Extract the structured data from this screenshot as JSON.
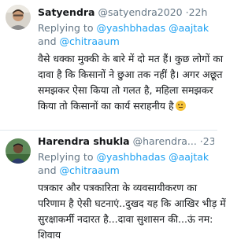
{
  "tweets": [
    {
      "name": "Satyendra",
      "handle": "@satyendra2020",
      "separator": "·",
      "time": "22h",
      "reply_prefix": "Replying to",
      "mention1": "@yashbhadas",
      "mention2": "@aajtak",
      "and_word": "and",
      "mention3": "@chitraaum",
      "lines": [
        "वैसे धक्का मुक्की के बारे में दो मत हैं। कुछ लोगों का",
        "दावा है कि किसानों ने छुआ तक नहीं है।  अगर अछूत",
        "समझकर ऐसा किया तो गलत है, महिला समझकर",
        "किया तो किसानों का कार्य सराहनीय है"
      ],
      "emoji": "thinking-face-emoji"
    },
    {
      "name": "Harendra shukla",
      "handle": "@harendra...",
      "separator": "·",
      "time": "23h",
      "reply_prefix": "Replying to",
      "mention1": "@yashbhadas",
      "mention2": "@aajtak",
      "and_word": "and",
      "mention3": "@chitraaum",
      "lines": [
        "पत्रकार और पत्रकारिता के व्यवसायीकरण का",
        "परिणाम है ऐसी घटनाएं..दुखद यह कि आखिर भीड़ में",
        "सुरक्षाकर्मी नदारत है...दावा सुशासन की...ऊं नम:",
        "शिवाय"
      ]
    }
  ]
}
